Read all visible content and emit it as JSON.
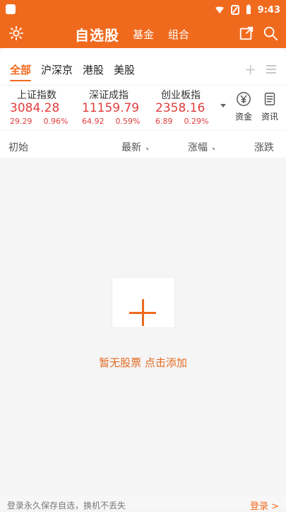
{
  "status": {
    "time": "9:43"
  },
  "header": {
    "title": "自选股",
    "tabs": [
      {
        "label": "基金"
      },
      {
        "label": "组合"
      }
    ]
  },
  "market_tabs": [
    {
      "label": "全部",
      "active": true
    },
    {
      "label": "沪深京"
    },
    {
      "label": "港股"
    },
    {
      "label": "美股"
    }
  ],
  "tab_actions": {
    "add_symbol": "+",
    "menu": "≡"
  },
  "indices": [
    {
      "name": "上证指数",
      "value": "3084.28",
      "change": "29.29",
      "pct": "0.96%"
    },
    {
      "name": "深证成指",
      "value": "11159.79",
      "change": "64.92",
      "pct": "0.59%"
    },
    {
      "name": "创业板指",
      "value": "2358.16",
      "change": "6.89",
      "pct": "0.29%"
    }
  ],
  "side_actions": {
    "funds": {
      "label": "资金"
    },
    "news": {
      "label": "资讯"
    }
  },
  "columns": {
    "first": "初始",
    "latest": "最新",
    "pct": "涨幅",
    "chg": "涨跌"
  },
  "empty_state": {
    "text": "暂无股票  点击添加"
  },
  "bottom": {
    "tip": "登录永久保存自选，换机不丢失",
    "login": "登录 >"
  },
  "colors": {
    "accent": "#f06a1e",
    "up": "#e23d3d"
  }
}
